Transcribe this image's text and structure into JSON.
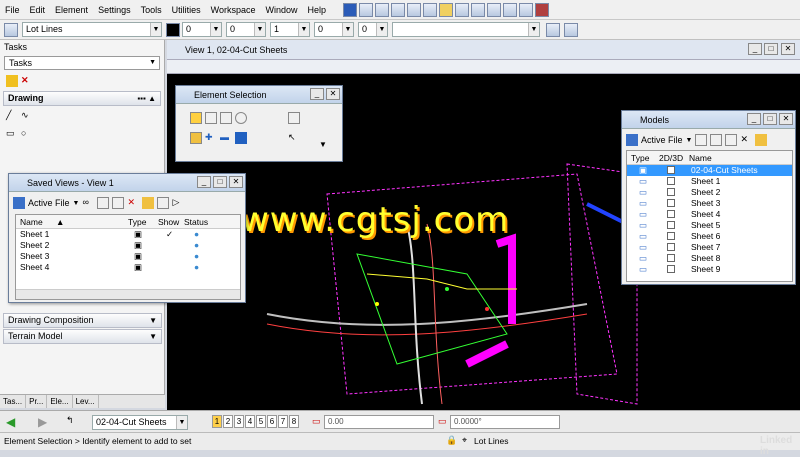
{
  "menu": [
    "File",
    "Edit",
    "Element",
    "Settings",
    "Tools",
    "Utilities",
    "Workspace",
    "Window",
    "Help"
  ],
  "toolbar": {
    "level_value": "Lot Lines",
    "color_value": "0",
    "style_value": "0",
    "weight_value": "1",
    "transparency_value": "0",
    "priority_value": "0"
  },
  "tasks": {
    "title": "Tasks",
    "dropdown": "Tasks",
    "drawing_label": "Drawing",
    "sections": [
      "Drawing Composition",
      "Terrain Model"
    ],
    "bottom_tabs": [
      "Tas...",
      "Pr...",
      "Ele...",
      "Lev..."
    ]
  },
  "view": {
    "title": "View 1, 02-04-Cut Sheets"
  },
  "element_selection": {
    "title": "Element Selection"
  },
  "saved_views": {
    "title": "Saved Views - View 1",
    "dropdown": "Active File",
    "columns": [
      "Name",
      "Type",
      "Show",
      "Status"
    ],
    "rows": [
      "Sheet 1",
      "Sheet 2",
      "Sheet 3",
      "Sheet 4"
    ],
    "checkmark": "✓"
  },
  "models": {
    "title": "Models",
    "dropdown": "Active File",
    "columns": [
      "Type",
      "2D/3D",
      "Name"
    ],
    "rows": [
      "02-04-Cut Sheets",
      "Sheet 1",
      "Sheet 2",
      "Sheet 3",
      "Sheet 4",
      "Sheet 5",
      "Sheet 6",
      "Sheet 7",
      "Sheet 8",
      "Sheet 9"
    ]
  },
  "statusbar": {
    "model_select": "02-04-Cut Sheets",
    "view_numbers": [
      "1",
      "2",
      "3",
      "4",
      "5",
      "6",
      "7",
      "8"
    ],
    "x_value": "0.00",
    "angle_value": "0.0000°",
    "message": "Element Selection > Identify element to add to set",
    "level": "Lot Lines"
  },
  "watermark": "www.cgtsj.com",
  "brand": "Linked in"
}
